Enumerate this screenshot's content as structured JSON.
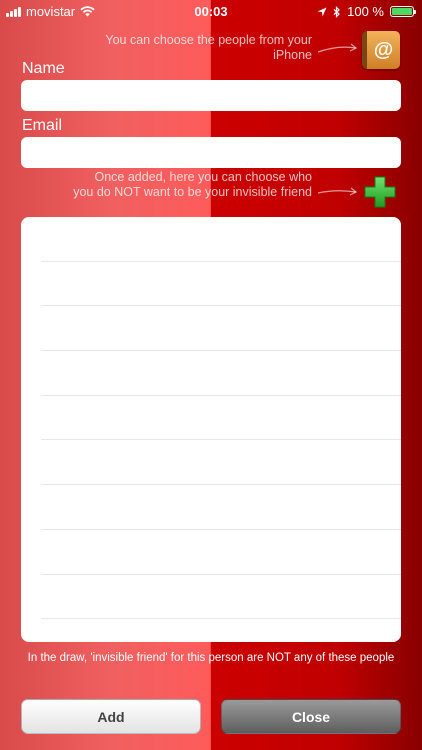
{
  "status_bar": {
    "carrier": "movistar",
    "time": "00:03",
    "battery": "100 %",
    "battery_level": 1.0
  },
  "hints": {
    "contacts_hint": "You can choose the people from your iPhone",
    "add_hint": "Once added, here you can choose who you do NOT want to be your invisible friend"
  },
  "form": {
    "name_label": "Name",
    "name_value": "",
    "email_label": "Email",
    "email_value": ""
  },
  "icons": {
    "contacts": "address-book-icon",
    "contacts_glyph": "@",
    "add": "green-plus-icon"
  },
  "list": {
    "rows": [
      "",
      "",
      "",
      "",
      "",
      "",
      "",
      "",
      "",
      ""
    ]
  },
  "footnote": "In the draw, 'invisible friend' for this person are NOT any of these people",
  "buttons": {
    "add_label": "Add",
    "close_label": "Close"
  },
  "colors": {
    "background_left": "#f06060",
    "background_right": "#c00000",
    "plus_green": "#2fb52f",
    "battery_green": "#4cd964"
  }
}
